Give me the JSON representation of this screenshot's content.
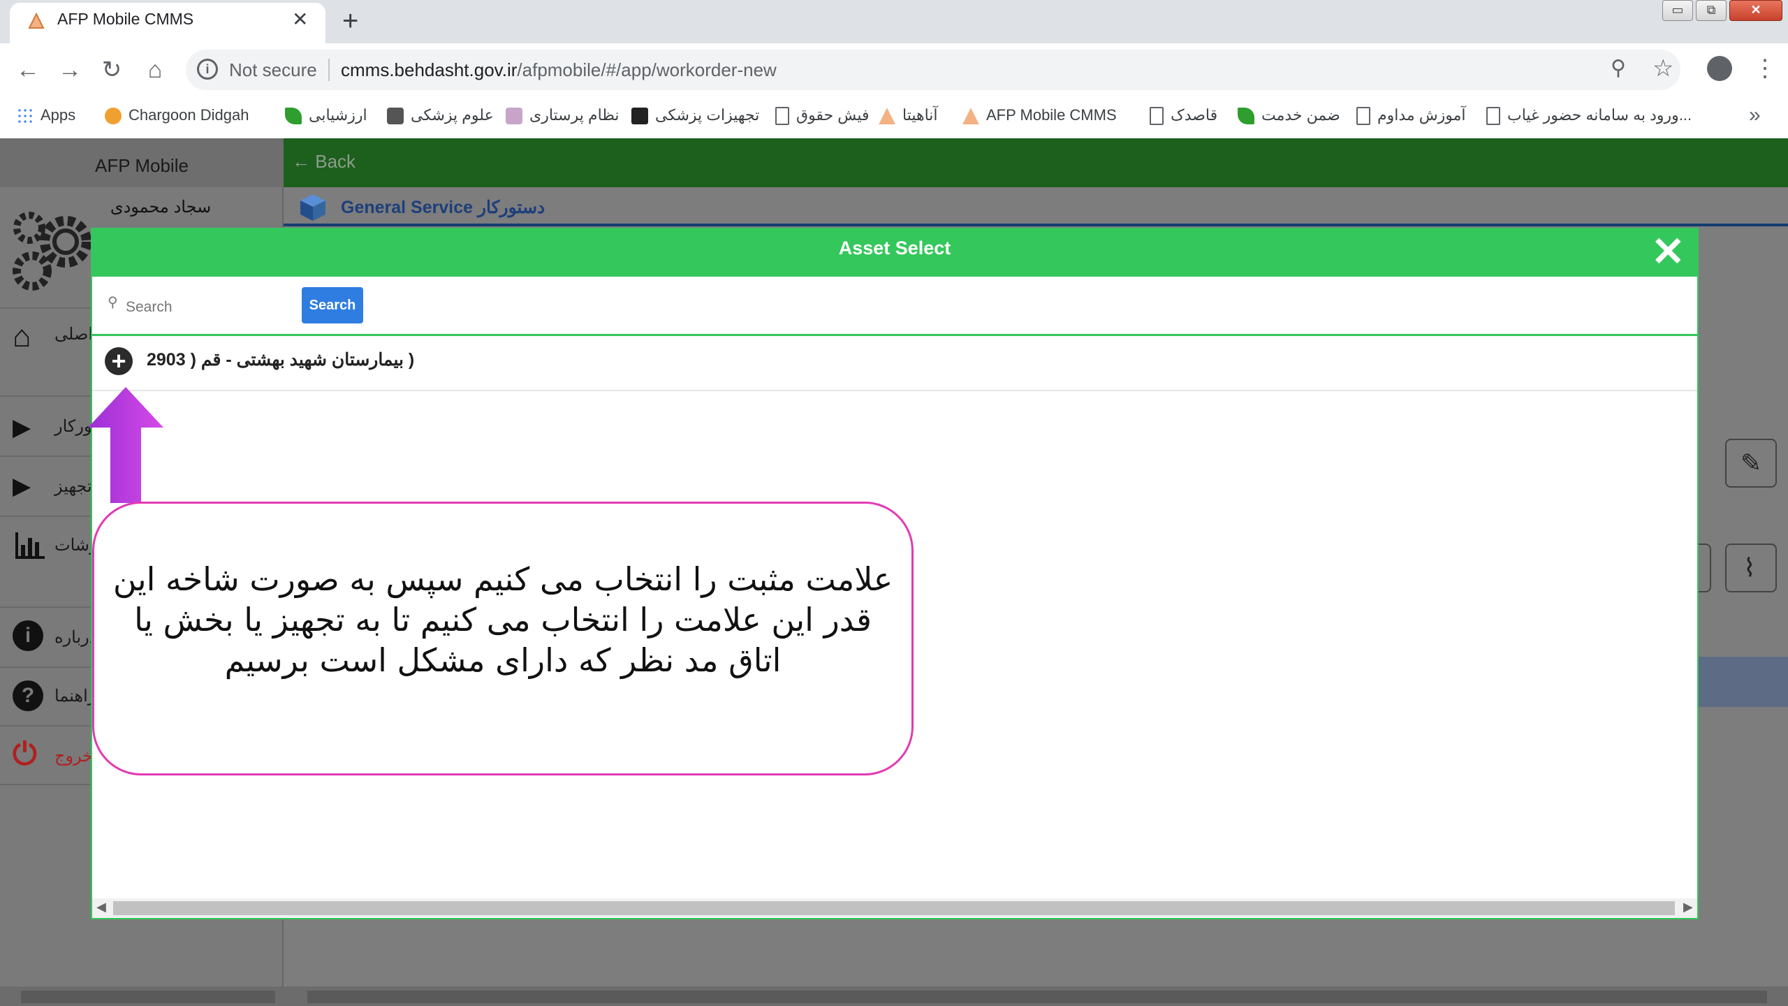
{
  "browser": {
    "tab_title": "AFP Mobile CMMS",
    "close_glyph": "✕",
    "newtab_glyph": "+",
    "win_min": "▭",
    "win_max": "⧉",
    "win_close": "✕",
    "not_secure": "Not secure",
    "url_host": "cmms.behdasht.gov.ir",
    "url_path": "/afpmobile/#/app/workorder-new",
    "bookmarks": [
      {
        "label": "Apps",
        "icon": "apps-icon"
      },
      {
        "label": "Chargoon Didgah",
        "icon": "chargoon-icon"
      },
      {
        "label": "ارزشیابی",
        "icon": "leaf-icon"
      },
      {
        "label": "علوم پزشکی",
        "icon": "site-icon"
      },
      {
        "label": "نظام پرستاری",
        "icon": "site-icon"
      },
      {
        "label": "تجهیزات پزشکی",
        "icon": "medical-kit-icon"
      },
      {
        "label": "فیش حقوق",
        "icon": "page-icon"
      },
      {
        "label": "آناهیتا",
        "icon": "afp-icon"
      },
      {
        "label": "AFP Mobile CMMS",
        "icon": "afp-icon"
      },
      {
        "label": "قاصدک",
        "icon": "page-icon"
      },
      {
        "label": "ضمن خدمت",
        "icon": "leaf-icon"
      },
      {
        "label": "آموزش مداوم",
        "icon": "page-icon"
      },
      {
        "label": "ورود به سامانه حضور غیاب...",
        "icon": "page-icon"
      }
    ],
    "more_glyph": "»"
  },
  "app": {
    "name": "AFP Mobile",
    "user": "سجاد محمودی",
    "back": "← Back",
    "subtitle": "General Service دستورکار",
    "sidebar": [
      {
        "label": "صفحه اصلی",
        "icon": "home-icon"
      },
      {
        "label": "دستورکار",
        "icon": "caret-right-icon"
      },
      {
        "label": "تجهیز",
        "icon": "caret-right-icon"
      },
      {
        "label": "گزارشات",
        "icon": "bar-chart-icon"
      },
      {
        "label": "درباره",
        "icon": "info-icon"
      },
      {
        "label": "راهنما",
        "icon": "help-icon"
      },
      {
        "label": "خروج",
        "icon": "power-icon"
      }
    ],
    "colors": {
      "header_green": "#1d5f1d",
      "modal_green": "#34c75c",
      "accent_blue": "#2f7de1",
      "callout_border": "#e23bb2",
      "arrow_purple": "#c13ce0"
    }
  },
  "modal": {
    "title": "Asset Select",
    "close": "✕",
    "search_placeholder": "Search",
    "search_button": "Search",
    "tree_item": "( بیمارستان شهید بهشتی - قم ( 2903",
    "expand": "+"
  },
  "annotation": {
    "text": "علامت مثبت را انتخاب می کنیم سپس به صورت شاخه این قدر این علامت را انتخاب می کنیم تا به تجهیز یا بخش یا اتاق مد نظر که دارای مشکل است برسیم"
  }
}
